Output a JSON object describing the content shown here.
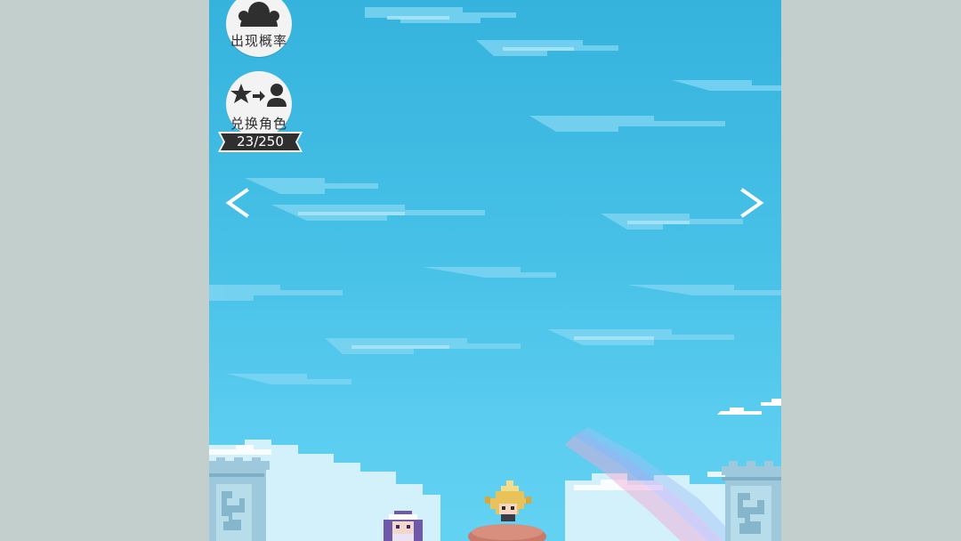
{
  "buttons": {
    "probability": {
      "label": "出现概率",
      "icon": "character-pool-icon"
    },
    "exchange": {
      "label": "兑换角色",
      "icon": "star-to-character-icon"
    }
  },
  "exchange_counter": {
    "value": "23/250"
  },
  "navigation": {
    "prev_icon": "chevron-left-icon",
    "next_icon": "chevron-right-icon"
  },
  "colors": {
    "sky_top": "#35b3dd",
    "sky_bottom": "#63d2f2",
    "side_background": "#c3cfcc",
    "button_bg": "#f3f3f3",
    "icon_dark": "#2f2f2f",
    "pedestal": "#c97a6a"
  }
}
